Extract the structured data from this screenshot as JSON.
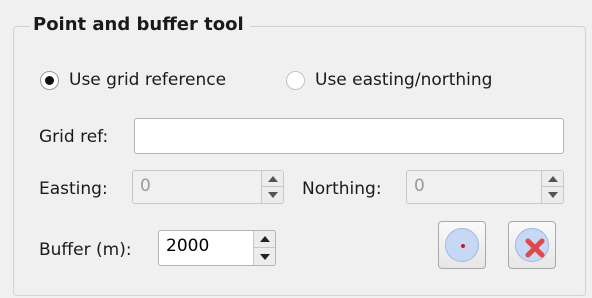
{
  "group": {
    "title": "Point and buffer tool"
  },
  "mode": {
    "grid_label": "Use grid reference",
    "grid_checked": true,
    "en_label": "Use easting/northing",
    "en_checked": false
  },
  "grid_ref": {
    "label": "Grid ref:",
    "value": ""
  },
  "easting": {
    "label": "Easting:",
    "value": "0"
  },
  "northing": {
    "label": "Northing:",
    "value": "0"
  },
  "buffer": {
    "label": "Buffer (m):",
    "value": "2000"
  },
  "icons": {
    "point": "point-icon",
    "clear": "clear-icon"
  },
  "colors": {
    "disc_fill": "#c7d8f4",
    "point_red": "#d01818",
    "x_red": "#e0464a"
  }
}
